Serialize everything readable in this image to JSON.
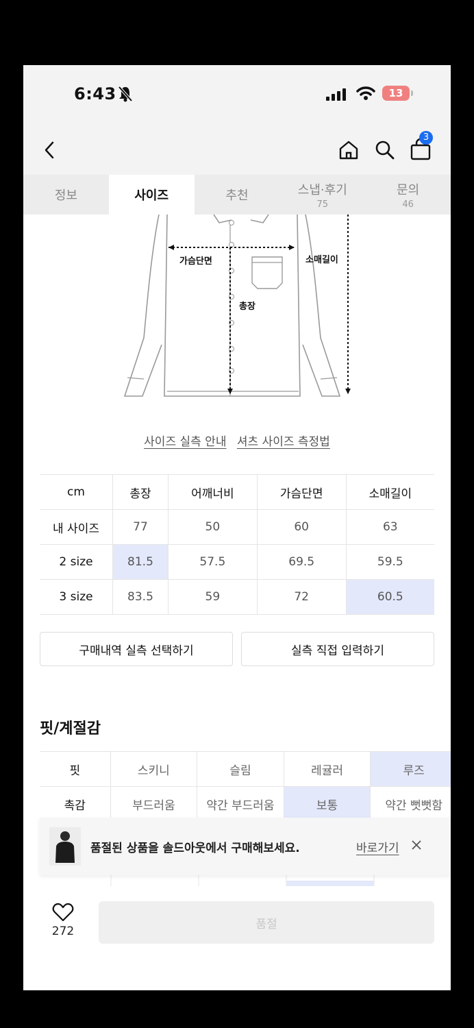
{
  "status": {
    "time": "6:43",
    "battery": "13"
  },
  "nav": {
    "cart_count": "3"
  },
  "tabs": [
    {
      "label": "정보",
      "count": ""
    },
    {
      "label": "사이즈",
      "count": ""
    },
    {
      "label": "추천",
      "count": ""
    },
    {
      "label": "스냅·후기",
      "count": "75"
    },
    {
      "label": "문의",
      "count": "46"
    }
  ],
  "diagram": {
    "chest": "가슴단면",
    "sleeve": "소매길이",
    "length": "총장"
  },
  "links": {
    "guide": "사이즈 실측 안내",
    "shirt": "셔츠 사이즈 측정법"
  },
  "size_table": {
    "headers": [
      "cm",
      "총장",
      "어깨너비",
      "가슴단면",
      "소매길이"
    ],
    "rows": [
      [
        "내 사이즈",
        "77",
        "50",
        "60",
        "63"
      ],
      [
        "2 size",
        "81.5",
        "57.5",
        "69.5",
        "59.5"
      ],
      [
        "3 size",
        "83.5",
        "59",
        "72",
        "60.5"
      ]
    ]
  },
  "buttons": {
    "history": "구매내역 실측 선택하기",
    "manual": "실측 직접 입력하기"
  },
  "fit": {
    "title": "핏/계절감",
    "rows": [
      [
        "핏",
        "스키니",
        "슬림",
        "레귤러",
        "루즈"
      ],
      [
        "촉감",
        "부드러움",
        "약간 부드러움",
        "보통",
        "약간 뻣뻣함"
      ]
    ]
  },
  "toast": {
    "text": "품절된 상품을 솔드아웃에서 구매해보세요.",
    "link": "바로가기"
  },
  "bottom": {
    "likes": "272",
    "soldout_label": "품절"
  },
  "colors": {
    "highlight": "#e4e8fb",
    "badge": "#1a6cf0",
    "battery": "#f08080"
  }
}
